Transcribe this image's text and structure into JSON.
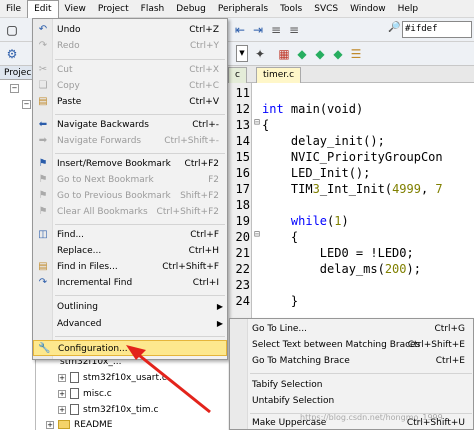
{
  "menubar": [
    "File",
    "Edit",
    "View",
    "Project",
    "Flash",
    "Debug",
    "Peripherals",
    "Tools",
    "SVCS",
    "Window",
    "Help"
  ],
  "toolbar": {
    "find_combo": "#ifdef"
  },
  "project_panel": {
    "tab": "Projec"
  },
  "tabs": [
    "c",
    "timer.c"
  ],
  "tree": [
    {
      "label": "stm32f10x_usart.c"
    },
    {
      "label": "misc.c"
    },
    {
      "label": "stm32f10x_tim.c"
    },
    {
      "label": "README"
    }
  ],
  "tree_partial": "stm32f10x_...",
  "editor": {
    "line_numbers": [
      "11",
      "12",
      "13",
      "14",
      "15",
      "16",
      "17",
      "18",
      "19",
      "20",
      "21",
      "22",
      "23",
      "24"
    ],
    "lines": [
      "",
      "int main(void)",
      "{",
      "    delay_init();",
      "    NVIC_PriorityGroupCon",
      "    LED_Init();",
      "    TIM3_Int_Init(4999, 7",
      "",
      "    while(1)",
      "    {",
      "        LED0 = !LED0;",
      "        delay_ms(200);",
      "",
      "    }"
    ]
  },
  "edit_menu": [
    {
      "label": "Undo",
      "shortcut": "Ctrl+Z",
      "icon": "undo-icon",
      "disabled": false
    },
    {
      "label": "Redo",
      "shortcut": "Ctrl+Y",
      "icon": "redo-icon",
      "disabled": true
    },
    {
      "label": "Cut",
      "shortcut": "Ctrl+X",
      "icon": "cut-icon",
      "disabled": true
    },
    {
      "label": "Copy",
      "shortcut": "Ctrl+C",
      "icon": "copy-icon",
      "disabled": true
    },
    {
      "label": "Paste",
      "shortcut": "Ctrl+V",
      "icon": "paste-icon",
      "disabled": false
    },
    {
      "label": "Navigate Backwards",
      "shortcut": "Ctrl+-",
      "icon": "back-arrow-icon",
      "disabled": false
    },
    {
      "label": "Navigate Forwards",
      "shortcut": "Ctrl+Shift+-",
      "icon": "forward-arrow-icon",
      "disabled": true
    },
    {
      "label": "Insert/Remove Bookmark",
      "shortcut": "Ctrl+F2",
      "icon": "bookmark-icon",
      "disabled": false
    },
    {
      "label": "Go to Next Bookmark",
      "shortcut": "F2",
      "icon": "next-bookmark-icon",
      "disabled": true
    },
    {
      "label": "Go to Previous Bookmark",
      "shortcut": "Shift+F2",
      "icon": "prev-bookmark-icon",
      "disabled": true
    },
    {
      "label": "Clear All Bookmarks",
      "shortcut": "Ctrl+Shift+F2",
      "icon": "clear-bookmarks-icon",
      "disabled": true
    },
    {
      "label": "Find...",
      "shortcut": "Ctrl+F",
      "icon": "find-icon",
      "disabled": false
    },
    {
      "label": "Replace...",
      "shortcut": "Ctrl+H",
      "icon": "",
      "disabled": false
    },
    {
      "label": "Find in Files...",
      "shortcut": "Ctrl+Shift+F",
      "icon": "find-in-files-icon",
      "disabled": false
    },
    {
      "label": "Incremental Find",
      "shortcut": "Ctrl+I",
      "icon": "incremental-find-icon",
      "disabled": false
    },
    {
      "label": "Outlining",
      "shortcut": "",
      "icon": "",
      "disabled": false
    },
    {
      "label": "Advanced",
      "shortcut": "",
      "icon": "",
      "disabled": false
    },
    {
      "label": "Configuration...",
      "shortcut": "",
      "icon": "wrench-icon",
      "disabled": false
    }
  ],
  "advanced_submenu": [
    {
      "label": "Go To Line...",
      "shortcut": "Ctrl+G"
    },
    {
      "label": "Select Text between Matching Braces",
      "shortcut": "Ctrl+Shift+E"
    },
    {
      "label": "Go To Matching Brace",
      "shortcut": "Ctrl+E"
    },
    {
      "label": "Tabify Selection",
      "shortcut": ""
    },
    {
      "label": "Untabify Selection",
      "shortcut": ""
    },
    {
      "label": "Make Uppercase",
      "shortcut": "Ctrl+Shift+U"
    }
  ],
  "watermark": "https://blog.csdn.net/hongmo_1999",
  "colors": {
    "highlight": "#fde88e",
    "keyword": "#0000ff",
    "number": "#808000",
    "arrow": "#e3231b"
  }
}
